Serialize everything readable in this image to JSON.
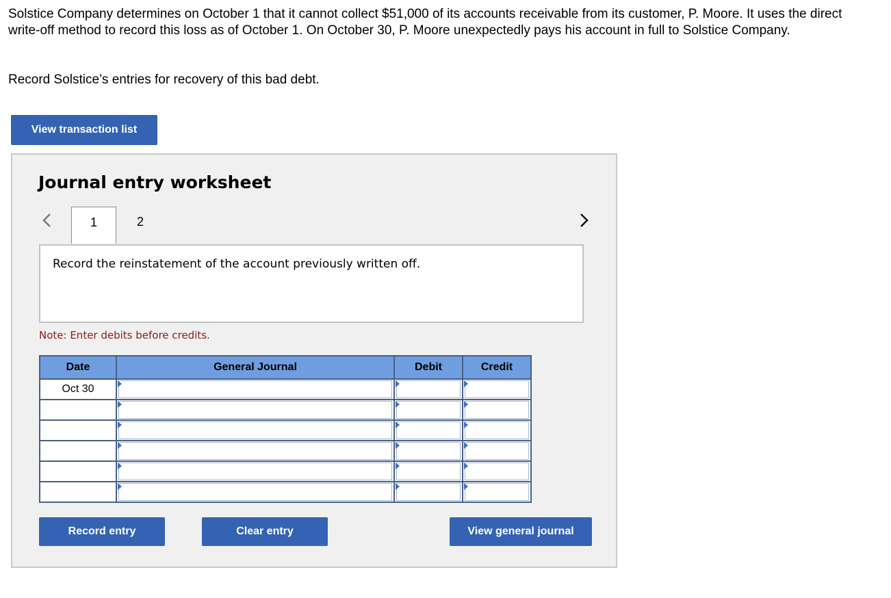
{
  "problem": {
    "text": "Solstice Company determines on October 1 that it cannot collect $51,000 of its accounts receivable from its customer, P. Moore. It uses the direct write-off method to record this loss as of October 1. On October 30, P. Moore unexpectedly pays his account in full to Solstice Company.",
    "instruction": "Record Solstice’s entries for recovery of this bad debt."
  },
  "buttons": {
    "view_transaction_list": "View transaction list",
    "record_entry": "Record entry",
    "clear_entry": "Clear entry",
    "view_general_journal": "View general journal"
  },
  "worksheet": {
    "title": "Journal entry worksheet",
    "tabs": [
      "1",
      "2"
    ],
    "active_tab": "1",
    "description": "Record the reinstatement of the account previously written off.",
    "note": "Note: Enter debits before credits."
  },
  "journal": {
    "headers": {
      "date": "Date",
      "general_journal": "General Journal",
      "debit": "Debit",
      "credit": "Credit"
    },
    "rows": [
      {
        "date": "Oct 30",
        "account": "",
        "debit": "",
        "credit": ""
      },
      {
        "date": "",
        "account": "",
        "debit": "",
        "credit": ""
      },
      {
        "date": "",
        "account": "",
        "debit": "",
        "credit": ""
      },
      {
        "date": "",
        "account": "",
        "debit": "",
        "credit": ""
      },
      {
        "date": "",
        "account": "",
        "debit": "",
        "credit": ""
      },
      {
        "date": "",
        "account": "",
        "debit": "",
        "credit": ""
      }
    ]
  },
  "colors": {
    "button": "#3563b4",
    "header": "#6f9ee0",
    "note": "#8b1a1a",
    "worksheet_bg": "#f0f0f0"
  },
  "icons": {
    "prev": "chevron-left-icon",
    "next": "chevron-right-icon",
    "dropdown_marker": "triangle-right-icon"
  }
}
